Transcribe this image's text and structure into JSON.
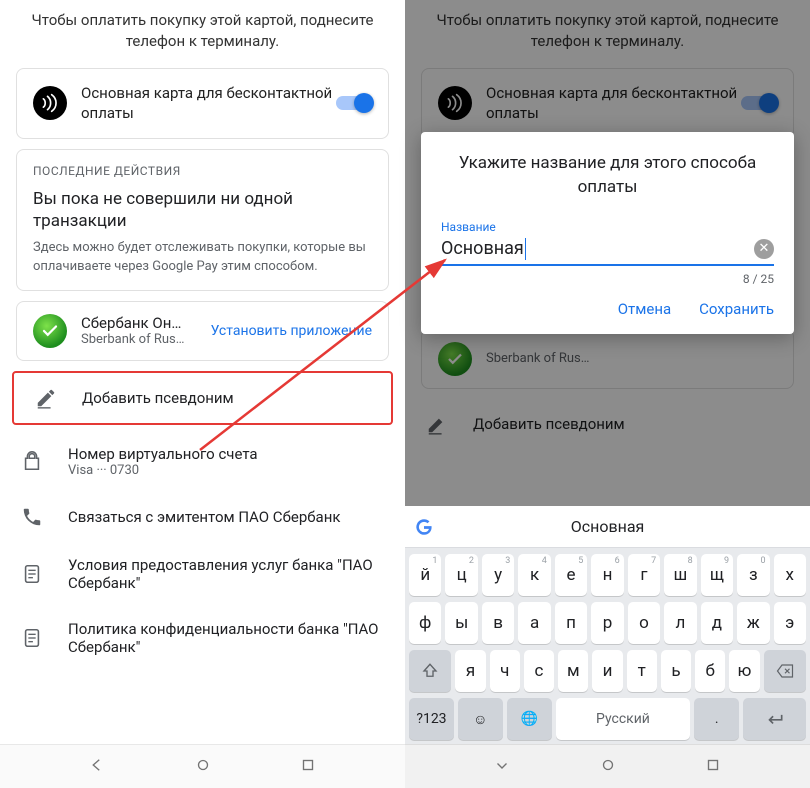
{
  "header_text": "Чтобы оплатить покупку этой картой, поднесите телефон к терминалу.",
  "contactless": {
    "label": "Основная карта для бесконтактной оплаты",
    "on": true
  },
  "recent": {
    "section": "ПОСЛЕДНИЕ ДЕЙСТВИЯ",
    "title": "Вы пока не совершили ни одной транзакции",
    "desc": "Здесь можно будет отслеживать покупки, которые вы оплачиваете через Google Pay этим способом."
  },
  "bank": {
    "title": "Сбербанк Он…",
    "subtitle": "Sberbank of Rus…",
    "install": "Установить приложение"
  },
  "items": {
    "add_nick": "Добавить псевдоним",
    "van_title": "Номер виртуального счета",
    "van_sub": "Visa ··· 0730",
    "contact": "Связаться с эмитентом ПАО Сбербанк",
    "terms": "Условия предоставления услуг банка \"ПАО Сбербанк\"",
    "privacy": "Политика конфиденциальности банка \"ПАО Сбербанк\""
  },
  "dialog": {
    "title": "Укажите название для этого способа оплаты",
    "field_label": "Название",
    "value": "Основная",
    "counter": "8 / 25",
    "cancel": "Отмена",
    "save": "Сохранить"
  },
  "keyboard": {
    "suggestion": "Основная",
    "lang": "Русский",
    "sym": "?123",
    "row1": [
      "й",
      "ц",
      "у",
      "к",
      "е",
      "н",
      "г",
      "ш",
      "щ",
      "з",
      "х"
    ],
    "row1_nums": [
      "1",
      "2",
      "3",
      "4",
      "5",
      "6",
      "7",
      "8",
      "9",
      "0",
      ""
    ],
    "row2": [
      "ф",
      "ы",
      "в",
      "а",
      "п",
      "р",
      "о",
      "л",
      "д",
      "ж",
      "э"
    ],
    "row3": [
      "я",
      "ч",
      "с",
      "м",
      "и",
      "т",
      "ь",
      "б",
      "ю"
    ]
  }
}
